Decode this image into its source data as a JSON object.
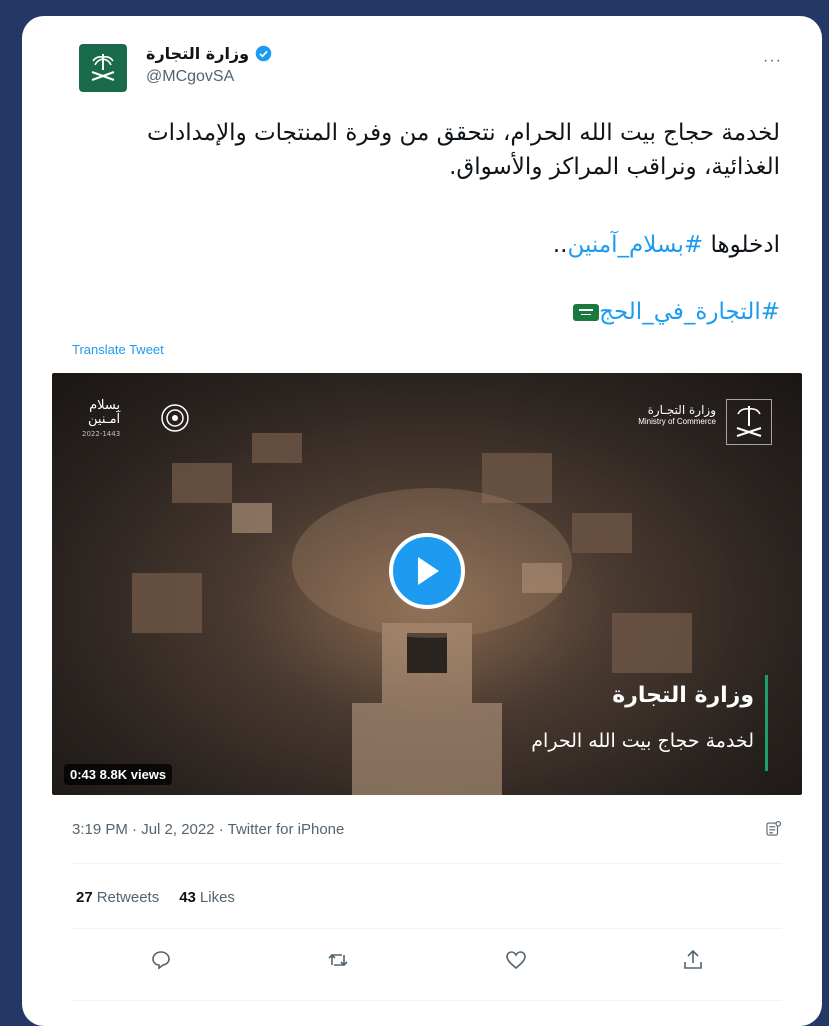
{
  "account": {
    "display_name": "وزارة التجارة",
    "handle": "@MCgovSA",
    "more_label": "···"
  },
  "tweet": {
    "line1": "لخدمة حجاج بيت الله الحرام، نتحقق من وفرة المنتجات والإمدادات الغذائية، ونراقب المراكز والأسواق.",
    "line2_prefix": "ادخلوها ",
    "line2_hashtag": "#بسلام_آمنين",
    "line2_suffix": "..",
    "hashtag2": "#التجارة_في_الحج",
    "translate_label": "Translate Tweet"
  },
  "media": {
    "duration": "0:43",
    "views": "8.8K views",
    "overlay_title": "وزارة التجارة",
    "overlay_subtitle": "لخدمة حجاج بيت الله الحرام",
    "mc_ar": "وزارة التجـارة",
    "mc_en": "Ministry of Commerce",
    "sa_title_1": "بسلام",
    "sa_title_2": "آمـنين",
    "sa_year": "2022-1443"
  },
  "meta": {
    "timestamp": "3:19 PM · Jul 2, 2022 · Twitter for iPhone"
  },
  "stats": {
    "retweets_count": "27",
    "retweets_label": "Retweets",
    "likes_count": "43",
    "likes_label": "Likes"
  },
  "colors": {
    "background": "#243866",
    "accent": "#1d9bf0",
    "brand_green": "#1a6b4b"
  }
}
